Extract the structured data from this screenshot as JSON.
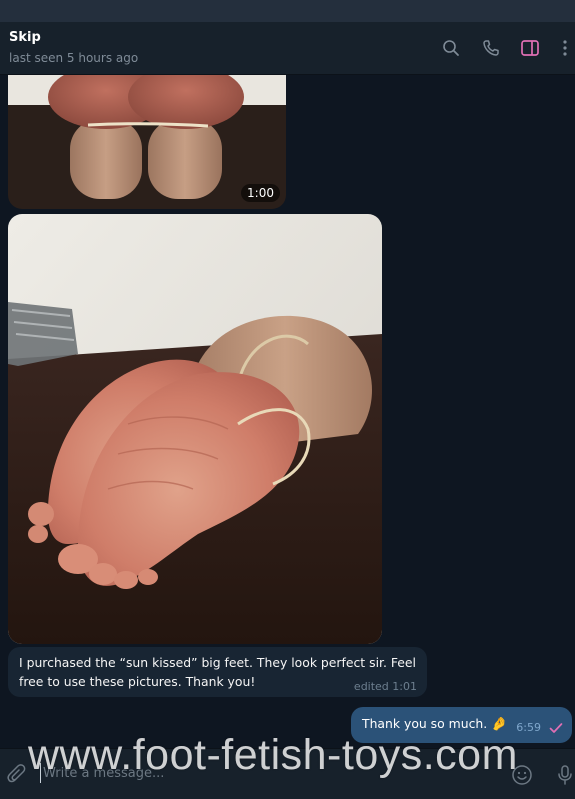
{
  "header": {
    "title": "Skip",
    "status": "last seen 5 hours ago"
  },
  "messages": {
    "video_duration": "1:00",
    "incoming_text": "I purchased the “sun kissed” big feet. They look perfect sir. Feel free to use these pictures. Thank you!",
    "incoming_meta": "edited 1:01",
    "outgoing_text": "Thank you so much.",
    "outgoing_emoji": "🤌",
    "outgoing_time": "6:59"
  },
  "composer": {
    "placeholder": "Write a message..."
  },
  "watermark": "www.foot-fetish-toys.com",
  "colors": {
    "background": "#0e1621",
    "header": "#17212b",
    "incoming_bubble": "#182533",
    "outgoing_bubble": "#2b5278",
    "accent_pink": "#e06fb4"
  },
  "icons": [
    "search-icon",
    "phone-icon",
    "sidebar-toggle-icon",
    "more-vertical-icon",
    "attach-icon",
    "emoji-icon",
    "microphone-icon",
    "read-check-icon"
  ]
}
